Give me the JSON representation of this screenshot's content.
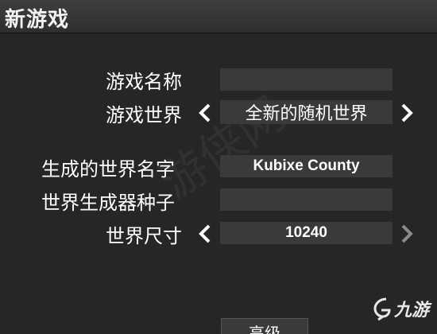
{
  "window": {
    "title": "新游戏"
  },
  "form": {
    "game_name": {
      "label": "游戏名称",
      "value": ""
    },
    "game_world": {
      "label": "游戏世界",
      "value": "全新的随机世界"
    },
    "generated_world_name": {
      "label": "生成的世界名字",
      "value": "Kubixe County"
    },
    "world_seed": {
      "label": "世界生成器种子",
      "value": ""
    },
    "world_size": {
      "label": "世界尺寸",
      "value": "10240"
    }
  },
  "buttons": {
    "advanced": "高级"
  },
  "watermark": {
    "text": "游侠网"
  },
  "logo": {
    "text": "九游"
  },
  "colors": {
    "background": "#262626",
    "field": "#3a3a3a",
    "arrow_active": "#ffffff",
    "arrow_disabled": "#8a8a8a"
  }
}
